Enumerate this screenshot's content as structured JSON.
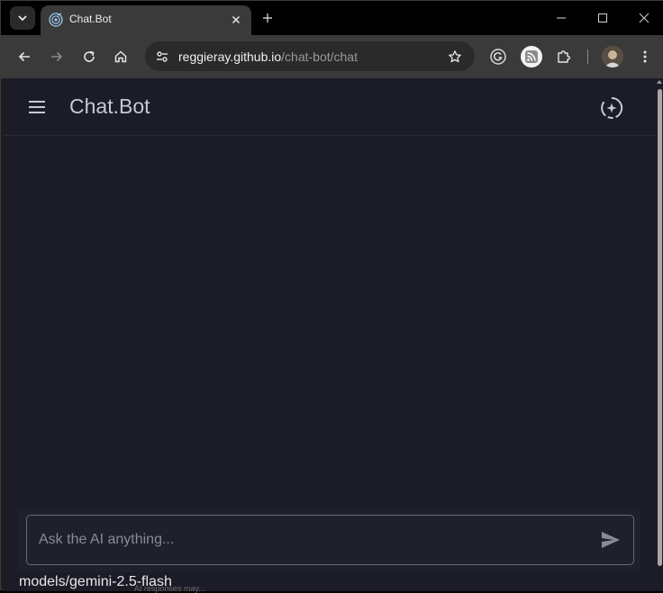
{
  "browser": {
    "tab": {
      "title": "Chat.Bot"
    },
    "address": {
      "host": "reggieray.github.io",
      "path": "/chat-bot/chat"
    }
  },
  "app": {
    "title": "Chat.Bot",
    "composer": {
      "placeholder": "Ask the AI anything...",
      "value": ""
    },
    "model": "models/gemini-2.5-flash",
    "ghost": "AI responses may..."
  },
  "colors": {
    "page_bg": "#1c1c28",
    "header_text": "#c8c8d0",
    "browser_chrome": "#3a3a3a"
  },
  "icons": {
    "menu": "hamburger-icon",
    "ai": "sparkle-circle-icon",
    "send": "send-icon"
  }
}
